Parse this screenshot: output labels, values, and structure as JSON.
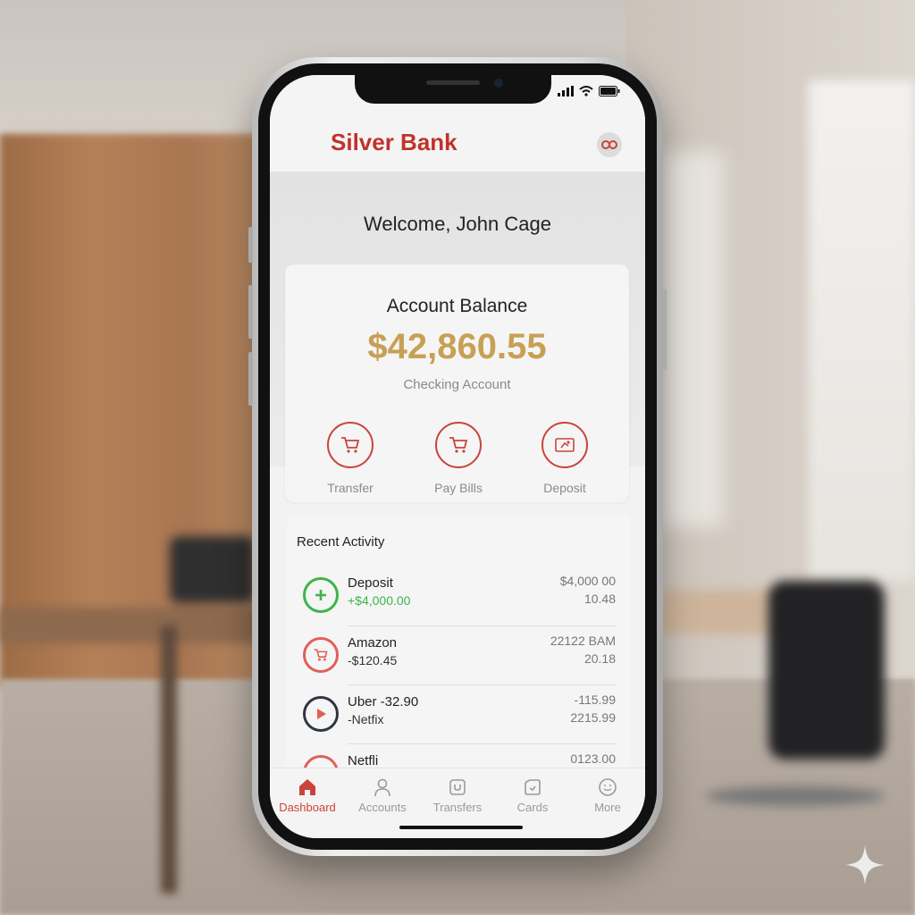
{
  "app": {
    "name": "Silver Bank",
    "brand_color": "#c0332b",
    "accent_gold": "#c8a055"
  },
  "header": {
    "welcome": "Welcome, John Cage",
    "profile_icon": "profile-icon"
  },
  "balance": {
    "label": "Account Balance",
    "amount": "$42,860.55",
    "account_type": "Checking Account"
  },
  "actions": [
    {
      "label": "Transfer",
      "icon": "cart-icon"
    },
    {
      "label": "Pay Bills",
      "icon": "cart-icon"
    },
    {
      "label": "Deposit",
      "icon": "deposit-icon"
    }
  ],
  "activity": {
    "title": "Recent Activity",
    "items": [
      {
        "name": "Deposit",
        "sub": "+$4,000.00",
        "right_top": "$4,000 00",
        "right_bottom": "10.48",
        "icon": "plus-icon",
        "color": "#3bb54a"
      },
      {
        "name": "Amazon",
        "sub": "-$120.45",
        "right_top": "22122 BAM",
        "right_bottom": "20.18",
        "icon": "cart-icon",
        "color": "#e06058"
      },
      {
        "name": "Uber  -32.90",
        "sub": "-Netfix",
        "right_top": "-115.99",
        "right_bottom": "2215.99",
        "icon": "play-icon",
        "color": "#2f3640"
      },
      {
        "name": "Netfli",
        "sub": "",
        "right_top": "0123.00",
        "right_bottom": "",
        "icon": "circle-icon",
        "color": "#e06058"
      }
    ]
  },
  "tabs": [
    {
      "label": "Dashboard",
      "icon": "home-icon",
      "active": true
    },
    {
      "label": "Accounts",
      "icon": "person-icon",
      "active": false
    },
    {
      "label": "Transfers",
      "icon": "transfer-icon",
      "active": false
    },
    {
      "label": "Cards",
      "icon": "card-icon",
      "active": false
    },
    {
      "label": "More",
      "icon": "more-icon",
      "active": false
    }
  ]
}
